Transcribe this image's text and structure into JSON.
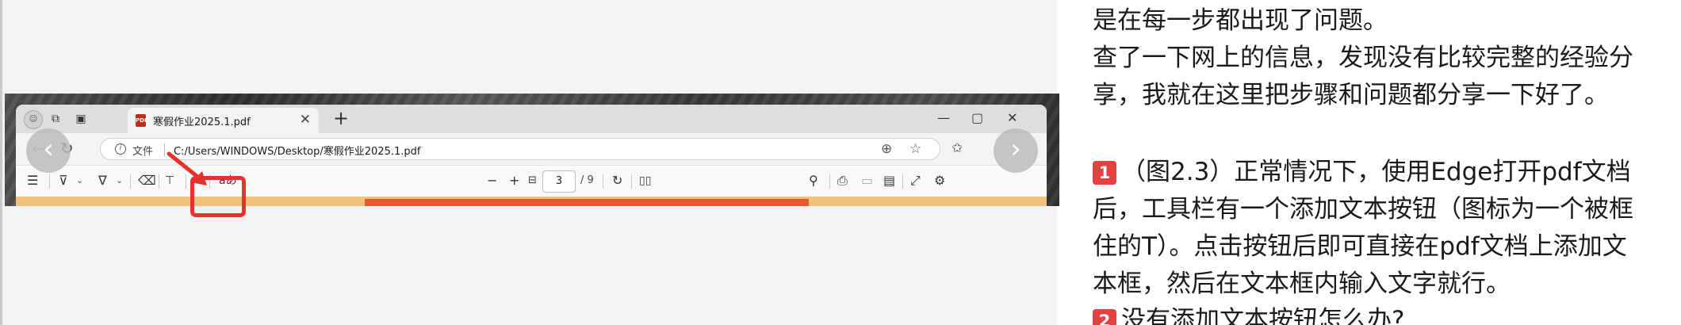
{
  "screenshot": {
    "browser": {
      "tab_title": "寒假作业2025.1.pdf",
      "tab_close": "✕",
      "new_tab": "+",
      "window_controls": [
        "—",
        "▢",
        "✕"
      ],
      "address": {
        "info_label": "文件",
        "url": "C:/Users/WINDOWS/Desktop/寒假作业2025.1.pdf"
      },
      "pdf_toolbar": {
        "read_aloud_label": "aあ",
        "zoom_out": "−",
        "zoom_in": "+",
        "page_current": "3",
        "page_total": "/ 9"
      }
    },
    "highlight_color": "#e8312d"
  },
  "carousel": {
    "prev_label": "‹",
    "next_label": "›"
  },
  "article": {
    "line1": "是在每一步都出现了问题。",
    "line2": "查了一下网上的信息，发现没有比较完整的经验分",
    "line3": "享，我就在这里把步骤和问题都分享一下好了。",
    "item1_badge": "1",
    "line4": "（图2.3）正常情况下，使用Edge打开pdf文档",
    "line5": "后，工具栏有一个添加文本按钮（图标为一个被框",
    "line6": "住的T）。点击按钮后即可直接在pdf文档上添加文",
    "line7": "本框，然后在文本框内输入文字就行。",
    "item2_badge": "2",
    "line8": "没有添加文本按钮怎么办?"
  },
  "icons": [
    "profile-avatar-icon",
    "workspaces-icon",
    "tab-actions-icon",
    "pdf-file-icon",
    "back-icon",
    "reload-icon",
    "info-icon",
    "translate-icon",
    "favorite-star-icon",
    "favorites-icon",
    "contents-icon",
    "highlight-icon",
    "draw-icon",
    "erase-icon",
    "add-text-icon",
    "read-aloud-icon",
    "fit-page-icon",
    "rotate-icon",
    "page-view-icon",
    "search-icon",
    "print-icon",
    "save-icon",
    "save-as-icon",
    "fullscreen-icon",
    "settings-icon",
    "chevron-left-icon",
    "chevron-right-icon"
  ]
}
